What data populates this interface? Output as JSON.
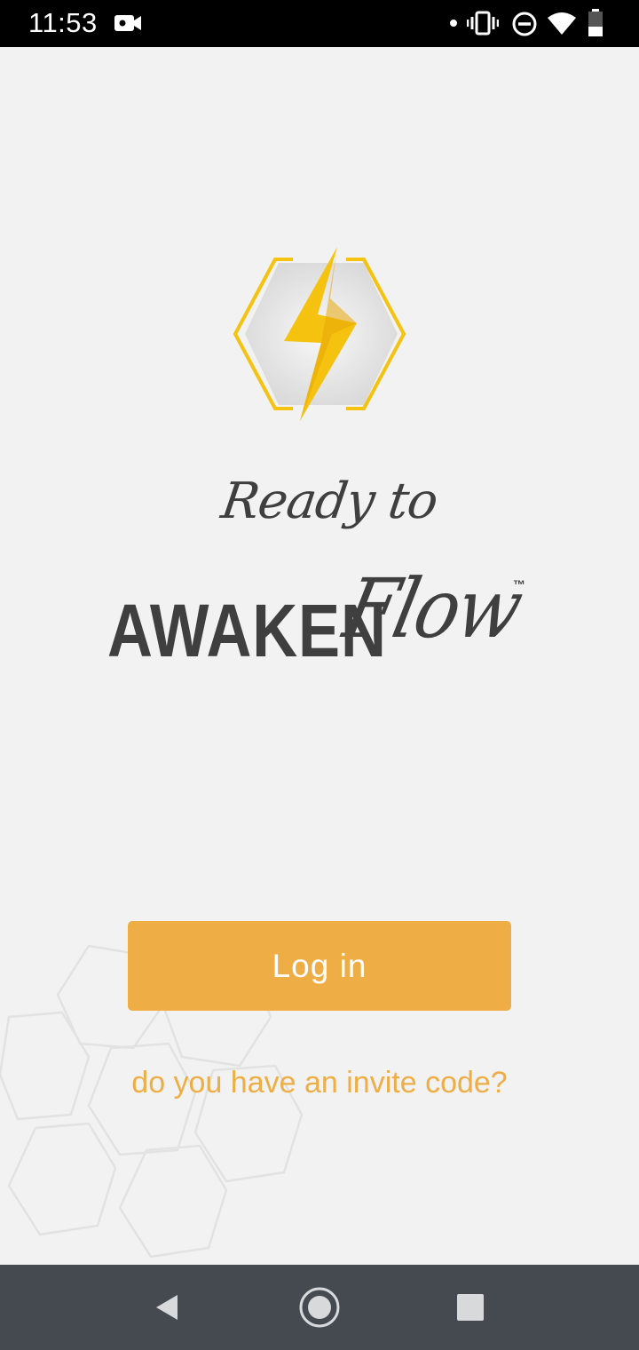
{
  "status_bar": {
    "time": "11:53",
    "icons": [
      "video-camera-icon",
      "notification-dot-icon",
      "vibrate-icon",
      "do-not-disturb-icon",
      "wifi-icon",
      "battery-icon"
    ]
  },
  "branding": {
    "tagline": "Ready to",
    "brand_word": "AWAKEN",
    "brand_script": "Flow",
    "trademark": "™",
    "logo_icon": "lightning-hexagon-logo",
    "accent_color": "#eeae45",
    "bolt_color": "#f5c20f",
    "text_color": "#3f3f3f"
  },
  "actions": {
    "login_label": "Log in",
    "invite_label": "do you have an invite code?"
  },
  "nav_bar": {
    "icons": [
      "back-icon",
      "home-icon",
      "recents-icon"
    ]
  }
}
